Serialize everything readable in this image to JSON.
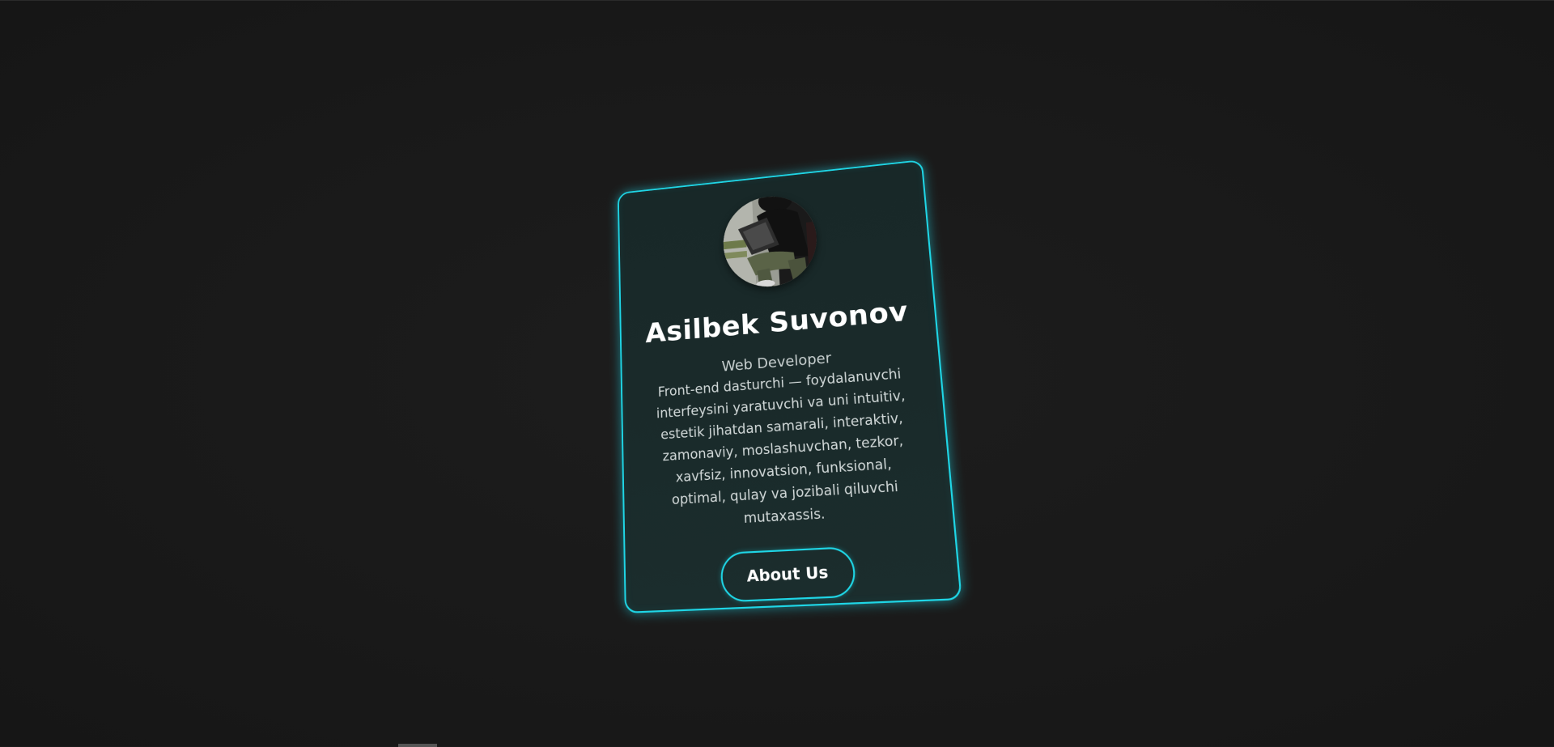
{
  "profile": {
    "name": "Asilbek Suvonov",
    "role": "Web Developer",
    "bio": "Front-end dasturchi — foydalanuvchi interfeysini yaratuvchi va uni intuitiv, estetik jihatdan samarali, interaktiv, zamonaviy, moslashuvchan, tezkor, xavfsiz, innovatsion, funksional, optimal, qulay va jozibali qiluvchi mutaxassis.",
    "avatar_icon": "person-photo",
    "button_label": "About Us"
  },
  "colors": {
    "accent": "#1fd6e6",
    "card_bg": "#1a2a2a",
    "page_bg": "#1a1a1a",
    "text_primary": "#ffffff",
    "text_secondary": "#c9d1d1"
  }
}
